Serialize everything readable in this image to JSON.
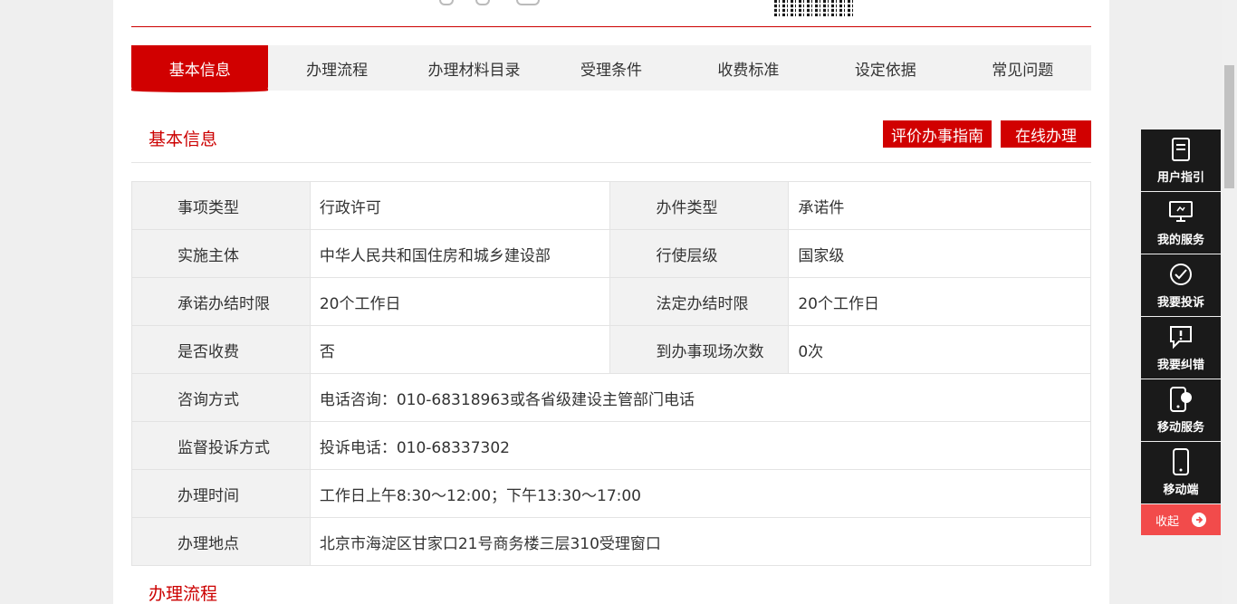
{
  "tabs": [
    {
      "label": "基本信息",
      "active": true
    },
    {
      "label": "办理流程"
    },
    {
      "label": "办理材料目录"
    },
    {
      "label": "受理条件"
    },
    {
      "label": "收费标准"
    },
    {
      "label": "设定依据"
    },
    {
      "label": "常见问题"
    }
  ],
  "section": {
    "title": "基本信息",
    "eval_button": "评价办事指南",
    "online_button": "在线办理"
  },
  "table": {
    "rows": [
      {
        "l1": "事项类型",
        "v1": "行政许可",
        "l2": "办件类型",
        "v2": "承诺件"
      },
      {
        "l1": "实施主体",
        "v1": "中华人民共和国住房和城乡建设部",
        "l2": "行使层级",
        "v2": "国家级"
      },
      {
        "l1": "承诺办结时限",
        "v1": "20个工作日",
        "l2": "法定办结时限",
        "v2": "20个工作日"
      },
      {
        "l1": "是否收费",
        "v1": "否",
        "l2": "到办事现场次数",
        "v2": "0次"
      }
    ],
    "wide_rows": [
      {
        "label": "咨询方式",
        "value": "电话咨询：010-68318963或各省级建设主管部门电话"
      },
      {
        "label": "监督投诉方式",
        "value": "投诉电话：010-68337302"
      },
      {
        "label": "办理时间",
        "value": "工作日上午8:30～12:00；下午13:30～17:00"
      },
      {
        "label": "办理地点",
        "value": "北京市海淀区甘家口21号商务楼三层310受理窗口"
      }
    ]
  },
  "next_section_title": "办理流程",
  "side_panel": {
    "items": [
      {
        "label": "用户指引",
        "icon": "document-icon"
      },
      {
        "label": "我的服务",
        "icon": "monitor-icon"
      },
      {
        "label": "我要投诉",
        "icon": "complaint-check-icon"
      },
      {
        "label": "我要纠错",
        "icon": "exclamation-chat-icon"
      },
      {
        "label": "移动服务",
        "icon": "mobile-cloud-icon"
      },
      {
        "label": "移动端",
        "icon": "phone-icon"
      }
    ],
    "collapse_label": "收起"
  },
  "colors": {
    "accent": "#d10000",
    "side_bg": "#1a1a1a",
    "collapse": "#f24b4b"
  }
}
